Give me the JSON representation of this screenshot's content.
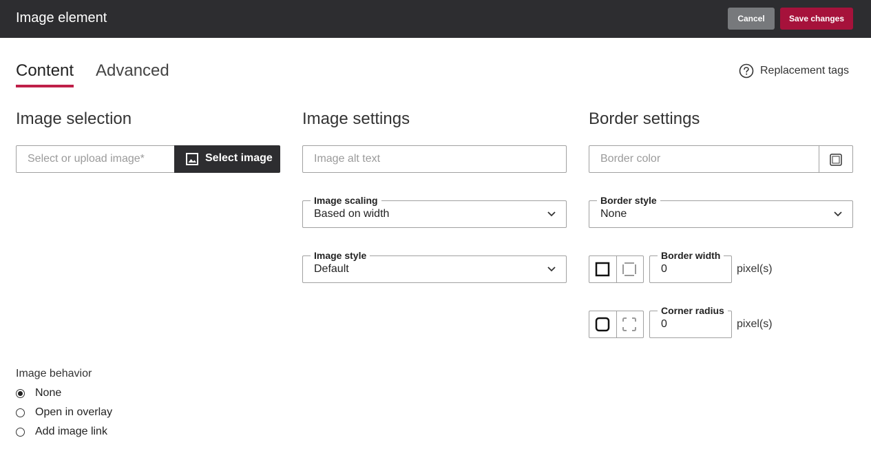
{
  "header": {
    "title": "Image element",
    "cancel_label": "Cancel",
    "save_label": "Save changes"
  },
  "tabs": [
    {
      "label": "Content",
      "active": true
    },
    {
      "label": "Advanced",
      "active": false
    }
  ],
  "replacement_tags_label": "Replacement tags",
  "image_selection": {
    "title": "Image selection",
    "image_placeholder": "Select or upload image*",
    "select_button_label": "Select image"
  },
  "image_settings": {
    "title": "Image settings",
    "alt_placeholder": "Image alt text",
    "scaling_label": "Image scaling",
    "scaling_value": "Based on width",
    "style_label": "Image style",
    "style_value": "Default"
  },
  "border_settings": {
    "title": "Border settings",
    "color_placeholder": "Border color",
    "style_label": "Border style",
    "style_value": "None",
    "width_label": "Border width",
    "width_value": "0",
    "width_unit": "pixel(s)",
    "radius_label": "Corner radius",
    "radius_value": "0",
    "radius_unit": "pixel(s)"
  },
  "image_behavior": {
    "label": "Image behavior",
    "options": [
      {
        "label": "None",
        "selected": true
      },
      {
        "label": "Open in overlay",
        "selected": false
      },
      {
        "label": "Add image link",
        "selected": false
      }
    ]
  },
  "colors": {
    "header_bg": "#2d2d30",
    "accent": "#a6123b",
    "tab_underline": "#bf1f48"
  }
}
